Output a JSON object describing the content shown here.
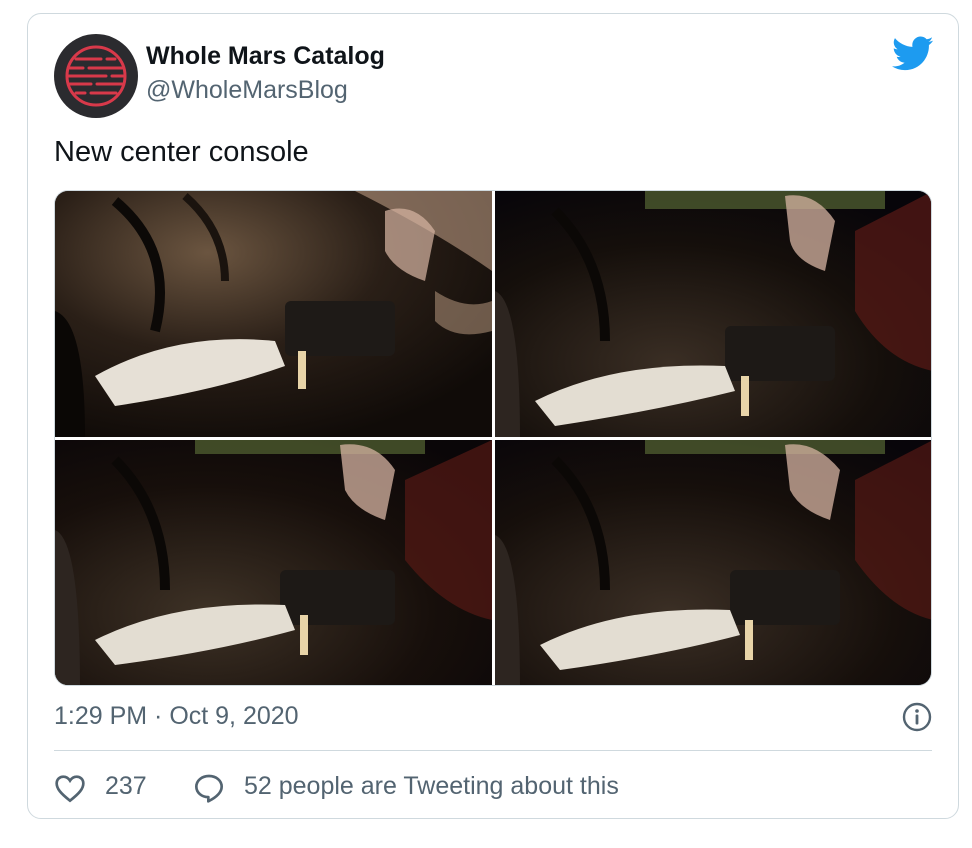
{
  "tweet": {
    "author_name": "Whole Mars Catalog",
    "author_handle": "@WholeMarsBlog",
    "text": "New center console",
    "timestamp": "1:29 PM · Oct 9, 2020",
    "likes": "237",
    "retweet_text": "52 people are Tweeting about this"
  },
  "media": {
    "photos": [
      {
        "subject": "car interior center console"
      },
      {
        "subject": "car interior center console"
      },
      {
        "subject": "car interior center console"
      },
      {
        "subject": "car interior center console"
      }
    ]
  },
  "icons": {
    "brand": "twitter-bird-icon",
    "info": "info-icon",
    "like": "heart-icon",
    "reply": "speech-bubble-icon"
  },
  "colors": {
    "brand_blue": "#1d9bf0",
    "text_primary": "#0f1419",
    "text_secondary": "#536471",
    "border": "#cfd9de",
    "avatar_accent": "#d8394a"
  }
}
